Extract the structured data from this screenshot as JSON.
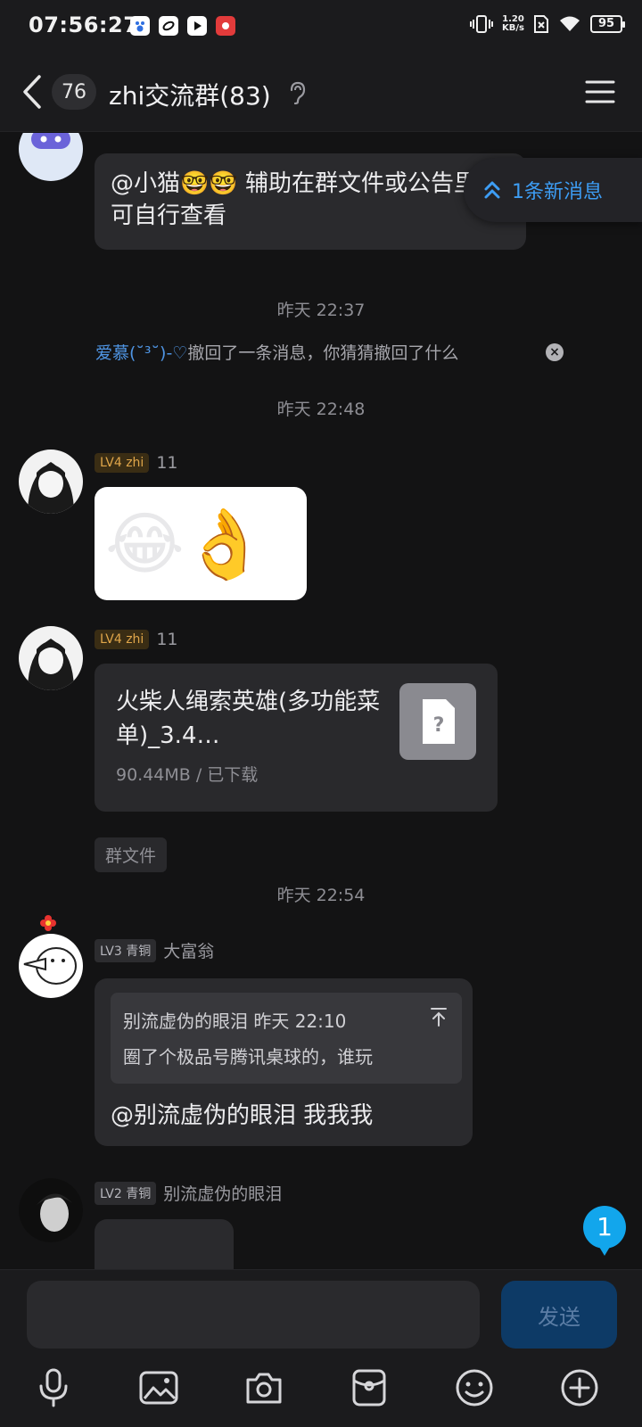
{
  "status": {
    "time": "07:56:27",
    "speed_top": "1.20",
    "speed_bottom": "KB/s",
    "battery": "95"
  },
  "header": {
    "back_count": "76",
    "title": "zhi交流群(83)"
  },
  "chat": {
    "new_message_pill": "1条新消息",
    "msg1": {
      "text": "@小猫🤓🤓 辅助在群文件或公告里，可自行查看"
    },
    "ts1": "昨天 22:37",
    "recall": {
      "name": "爱慕(˘³˘)-♡",
      "text": "撤回了一条消息，你猜猜撤回了什么"
    },
    "ts2": "昨天 22:48",
    "msg2": {
      "level": "LV4 zhi",
      "name": "11",
      "sticker": "😂👌"
    },
    "msg3": {
      "level": "LV4 zhi",
      "name": "11",
      "file_name": "火柴人绳索英雄(多功能菜单)_3.4…",
      "file_meta": "90.44MB / 已下载",
      "tag": "群文件"
    },
    "ts3": "昨天 22:54",
    "msg4": {
      "level": "LV3 青铜",
      "name": "大富翁",
      "quote_head": "别流虚伪的眼泪 昨天 22:10",
      "quote_body": "圈了个极品号腾讯桌球的，谁玩",
      "text": "@别流虚伪的眼泪 我我我"
    },
    "msg5": {
      "level": "LV2 青铜",
      "name": "别流虚伪的眼泪"
    },
    "float_badge": "1"
  },
  "input": {
    "placeholder": "",
    "send_label": "发送"
  },
  "icons": [
    "mic-icon",
    "image-icon",
    "camera-icon",
    "red-packet-icon",
    "emoji-icon",
    "plus-icon"
  ]
}
